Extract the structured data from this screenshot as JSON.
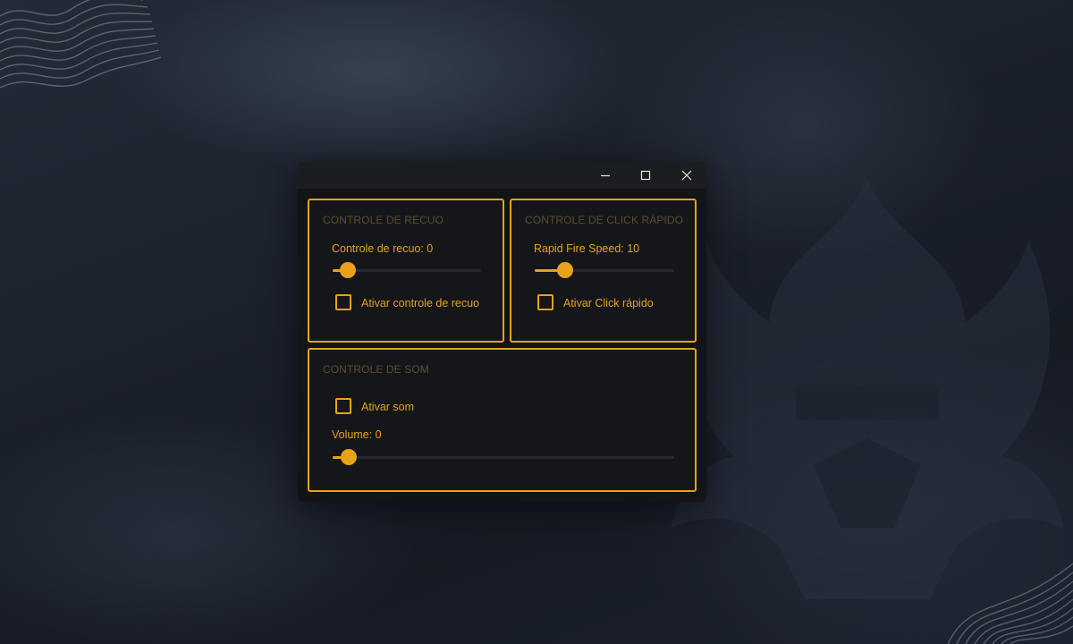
{
  "window": {
    "minimize_icon": "minimize-icon",
    "maximize_icon": "maximize-icon",
    "close_icon": "close-icon"
  },
  "recoil": {
    "title": "CONTROLE DE RECUO",
    "slider_label": "Controle de recuo: 0",
    "slider_fraction": 0.04,
    "checkbox_label": "Ativar controle de recuo",
    "checked": false
  },
  "rapid": {
    "title": "CONTROLE DE CLICK RÁPIDO",
    "slider_label": "Rapid Fire Speed: 10",
    "slider_fraction": 0.16,
    "checkbox_label": "Ativar Click rápido",
    "checked": false
  },
  "sound": {
    "title": "CONTROLE DE SOM",
    "checkbox_label": "Ativar som",
    "checked": false,
    "volume_label": "Volume: 0",
    "slider_fraction": 0.02
  },
  "colors": {
    "accent": "#e8a21a",
    "panel_bg": "#141619",
    "titlebar_bg": "#1c1d20",
    "muted_title": "#5c4d2e"
  }
}
